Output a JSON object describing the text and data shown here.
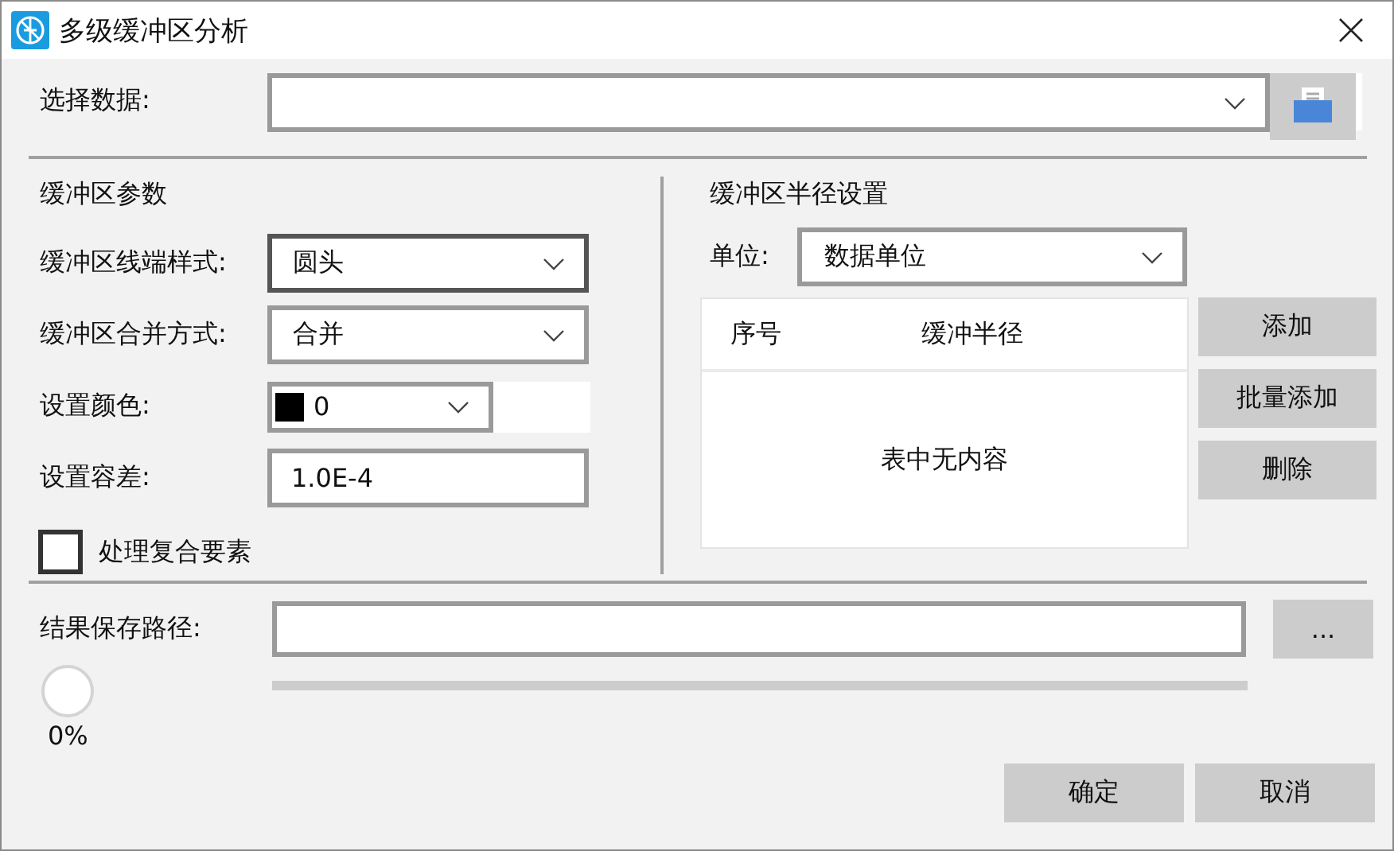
{
  "window": {
    "title": "多级缓冲区分析"
  },
  "data_select": {
    "label": "选择数据:"
  },
  "params": {
    "heading": "缓冲区参数",
    "fields": [
      {
        "kind": "combo",
        "label": "缓冲区线端样式:",
        "value": "圆头",
        "focused": true
      },
      {
        "kind": "combo",
        "label": "缓冲区合并方式:",
        "value": "合并",
        "focused": false
      },
      {
        "kind": "color",
        "label": "设置颜色:",
        "value": "0",
        "color": "#000000",
        "focused": false
      },
      {
        "kind": "text",
        "label": "设置容差:",
        "value": "1.0E-4",
        "focused": false
      }
    ],
    "checkbox": {
      "label": "处理复合要素",
      "checked": false
    }
  },
  "radius": {
    "heading": "缓冲区半径设置",
    "unit": {
      "label": "单位:",
      "value": "数据单位"
    },
    "table": {
      "columns": [
        "序号",
        "缓冲半径"
      ],
      "empty_text": "表中无内容"
    },
    "buttons": [
      "添加",
      "批量添加",
      "删除"
    ]
  },
  "output": {
    "label": "结果保存路径:",
    "browse": "...",
    "progress": {
      "level": 0,
      "reading": "0%"
    }
  },
  "buttons": [
    "确定",
    "取消"
  ]
}
